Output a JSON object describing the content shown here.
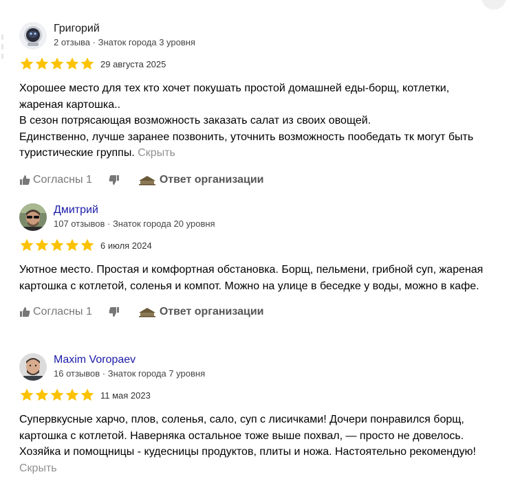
{
  "reviews": [
    {
      "author": "Григорий",
      "meta": "2 отзыва · Знаток города 3 уровня",
      "stars": 5,
      "date": "29 августа 2025",
      "paragraphs": [
        "Хорошее место для тех кто хочет покушать простой домашней еды-борщ, котлетки, жареная картошка..",
        "В сезон потрясающая возможность заказать салат из своих овощей.",
        "Единственно, лучше заранее позвонить, уточнить возможность пообедать тк могут быть туристические группы."
      ],
      "collapse_label": "Скрыть",
      "like_label": "Согласны 1",
      "org_reply_label": "Ответ организации"
    },
    {
      "author": "Дмитрий",
      "meta": "107 отзывов · Знаток города 20 уровня",
      "stars": 5,
      "date": "6 июля 2024",
      "paragraphs": [
        "Уютное место. Простая и комфортная обстановка. Борщ, пельмени, грибной суп, жареная картошка с котлетой, соленья и компот. Можно на улице в беседке у воды, можно в кафе."
      ],
      "like_label": "Согласны 1",
      "org_reply_label": "Ответ организации"
    },
    {
      "author": "Maxim Voropaev",
      "meta": "16 отзывов · Знаток города 7 уровня",
      "stars": 5,
      "date": "11 мая 2023",
      "paragraphs": [
        "Супервкусные харчо, плов, соленья, сало, суп с лисичками! Дочери понравился борщ, картошка с котлетой. Наверняка остальное тоже выше похвал, — просто не довелось.",
        "Хозяйка и помощницы - кудесницы продуктов, плиты и ножа. Настоятельно рекомендую!"
      ],
      "collapse_label": "Скрыть"
    }
  ],
  "colors": {
    "star": "#fcc200",
    "link": "#1a1aa8",
    "muted": "#909090"
  }
}
